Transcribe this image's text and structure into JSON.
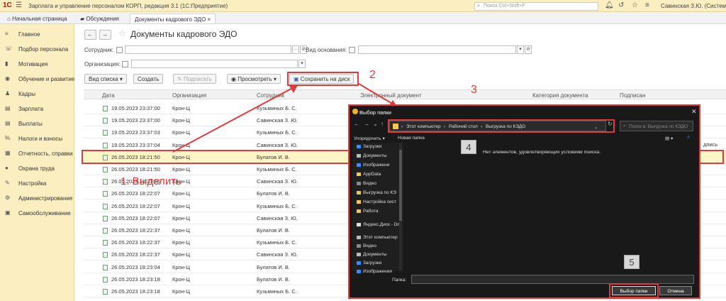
{
  "titlebar": {
    "logo": "1С",
    "title": "Зарплата и управление персоналом КОРП, редакция 3.1  (1С:Предприятие)",
    "search_placeholder": "Поиск Ctrl+Shift+F",
    "user": "Савинская З.Ю. (Систем"
  },
  "tabs": [
    {
      "label": "Начальная страница"
    },
    {
      "label": "Обсуждения"
    },
    {
      "label": "Документы кадрового ЭДО ×"
    }
  ],
  "sidebar": {
    "items": [
      {
        "label": "Главное",
        "icon": "≡"
      },
      {
        "label": "Подбор персонала",
        "icon": "☏"
      },
      {
        "label": "Мотивация",
        "icon": "▮"
      },
      {
        "label": "Обучение и развитие",
        "icon": "◉"
      },
      {
        "label": "Кадры",
        "icon": "♟"
      },
      {
        "label": "Зарплата",
        "icon": "▤"
      },
      {
        "label": "Выплаты",
        "icon": "▤"
      },
      {
        "label": "Налоги и взносы",
        "icon": "%"
      },
      {
        "label": "Отчетность, справки",
        "icon": "▦"
      },
      {
        "label": "Охрана труда",
        "icon": "●"
      },
      {
        "label": "Настройка",
        "icon": "✎"
      },
      {
        "label": "Администрирование",
        "icon": "⚙"
      },
      {
        "label": "Самообслуживание",
        "icon": "▣"
      }
    ]
  },
  "page": {
    "title": "Документы кадрового ЭДО",
    "filters": {
      "employee_label": "Сотрудник:",
      "basis_label": "Вид основания:",
      "org_label": "Организация:"
    },
    "toolbar": {
      "view_list": "Вид списка ▾",
      "create": "Создать",
      "sign": "Подписать",
      "preview": "Просмотреть ▾",
      "save_to_disk": "Сохранить на диск"
    },
    "columns": [
      "Дата",
      "Организация",
      "Сотрудник",
      "Электронный документ",
      "Категория документа",
      "Подписан"
    ],
    "rows": [
      {
        "date": "19.05.2023 23:37:00",
        "org": "Крон-Ц",
        "emp": "Кузьминых Б. С."
      },
      {
        "date": "19.05.2023 23:37:00",
        "org": "Крон-Ц",
        "emp": "Савинская З. Ю."
      },
      {
        "date": "19.05.2023 23:37:03",
        "org": "Крон-Ц",
        "emp": "Кузьминых Б. С."
      },
      {
        "date": "19.05.2023 23:37:04",
        "org": "Крон-Ц",
        "emp": "Савинская З. Ю."
      },
      {
        "date": "26.05.2023 18:21:50",
        "org": "Крон-Ц",
        "emp": "Булатов И. В."
      },
      {
        "date": "26.05.2023 18:21:50",
        "org": "Крон-Ц",
        "emp": "Кузьминых Б. С."
      },
      {
        "date": "26.05.2023 18:21:50",
        "org": "Крон-Ц",
        "emp": "Савинская З. Ю."
      },
      {
        "date": "26.05.2023 18:22:07",
        "org": "Крон-Ц",
        "emp": "Булатов И. В."
      },
      {
        "date": "26.05.2023 18:22:07",
        "org": "Крон-Ц",
        "emp": "Кузьминых Б. С."
      },
      {
        "date": "26.05.2023 18:22:07",
        "org": "Крон-Ц",
        "emp": "Савинская З. Ю."
      },
      {
        "date": "26.05.2023 18:22:37",
        "org": "Крон-Ц",
        "emp": "Булатов И. В."
      },
      {
        "date": "26.05.2023 18:22:37",
        "org": "Крон-Ц",
        "emp": "Кузьминых Б. С."
      },
      {
        "date": "26.05.2023 18:22:37",
        "org": "Крон-Ц",
        "emp": "Савинская З. Ю."
      },
      {
        "date": "26.05.2023 18:23:04",
        "org": "Крон-Ц",
        "emp": "Булатов И. В."
      },
      {
        "date": "26.05.2023 18:23:18",
        "org": "Крон-Ц",
        "emp": "Булатов И. В."
      },
      {
        "date": "26.05.2023 18:23:18",
        "org": "Крон-Ц",
        "emp": "Кузьминых Б. С."
      }
    ],
    "partial_text": "дпись"
  },
  "dialog": {
    "title": "Выбор папки",
    "close": "✕",
    "address": [
      "Этот компьютер",
      "Рабочий стол",
      "Выгрузка по КЭДО"
    ],
    "search_placeholder": "Поиск в: Выгрузка по КЭДО",
    "organize": "Упорядочить ▾",
    "new_folder": "Новая папка",
    "tree": [
      "Загрузки",
      "Документы",
      "Изображени",
      "AppData",
      "Видео",
      "Выгрузка по КЭ",
      "Настройка сист",
      "Работа",
      "Яндекс.Диск - Dm",
      "Этот компьютер",
      "Видео",
      "Документы",
      "Загрузки",
      "Изображения"
    ],
    "empty_message": "Нет элементов, удовлетворяющих условиям поиска.",
    "folder_label": "Папка:",
    "select_button": "Выбор папки",
    "cancel_button": "Отмена"
  },
  "annotations": {
    "step1": "1. Выделить",
    "step2": "2",
    "step3": "3",
    "step4": "4",
    "step5": "5"
  },
  "colors": {
    "accent_red": "#e03a3a",
    "titlebar_bg": "#fbeec1",
    "dialog_bg": "#191919"
  }
}
